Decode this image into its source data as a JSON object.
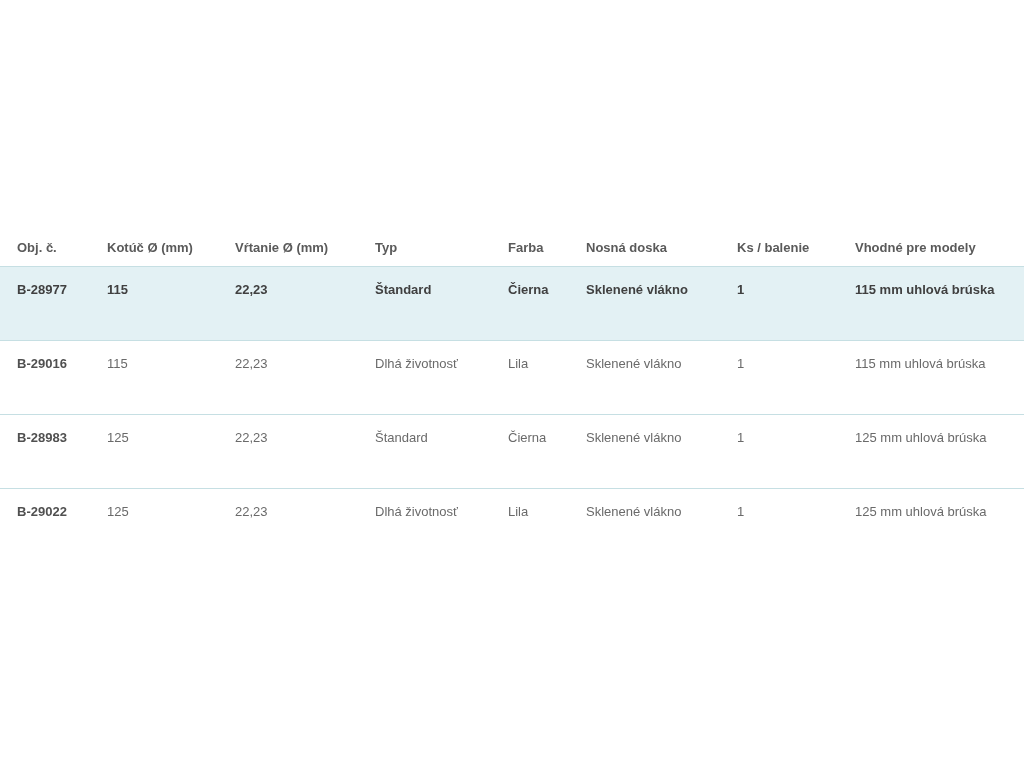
{
  "table": {
    "columns": [
      "Obj. č.",
      "Kotúč Ø (mm)",
      "Vŕtanie Ø (mm)",
      "Typ",
      "Farba",
      "Nosná doska",
      "Ks / balenie",
      "Vhodné pre modely"
    ],
    "rows": [
      {
        "selected": true,
        "cells": [
          "B-28977",
          "115",
          "22,23",
          "Štandard",
          "Čierna",
          "Sklenené vlákno",
          "1",
          "115 mm uhlová brúska"
        ]
      },
      {
        "selected": false,
        "cells": [
          "B-29016",
          "115",
          "22,23",
          "Dlhá životnosť",
          "Lila",
          "Sklenené vlákno",
          "1",
          "115 mm uhlová brúska"
        ]
      },
      {
        "selected": false,
        "cells": [
          "B-28983",
          "125",
          "22,23",
          "Štandard",
          "Čierna",
          "Sklenené vlákno",
          "1",
          "125 mm uhlová brúska"
        ]
      },
      {
        "selected": false,
        "cells": [
          "B-29022",
          "125",
          "22,23",
          "Dlhá životnosť",
          "Lila",
          "Sklenené vlákno",
          "1",
          "125 mm uhlová brúska"
        ]
      }
    ]
  }
}
